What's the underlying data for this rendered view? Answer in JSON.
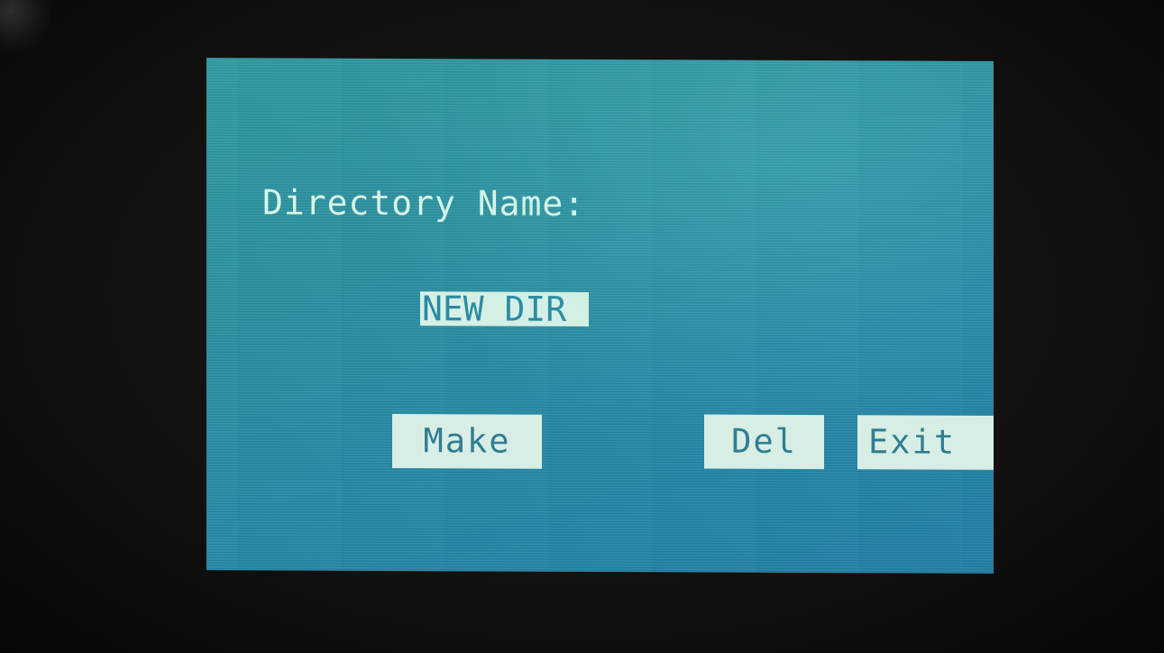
{
  "screen": {
    "title": "Directory Name:",
    "name_value": "NEW_DIR_",
    "buttons": {
      "make": "Make",
      "del": "Del",
      "exit": "Exit"
    }
  },
  "colors": {
    "lcd_background": "#2a8fa3",
    "lcd_text": "#d8f5e8",
    "button_background": "#d8eee4",
    "button_text": "#2f7e93"
  }
}
